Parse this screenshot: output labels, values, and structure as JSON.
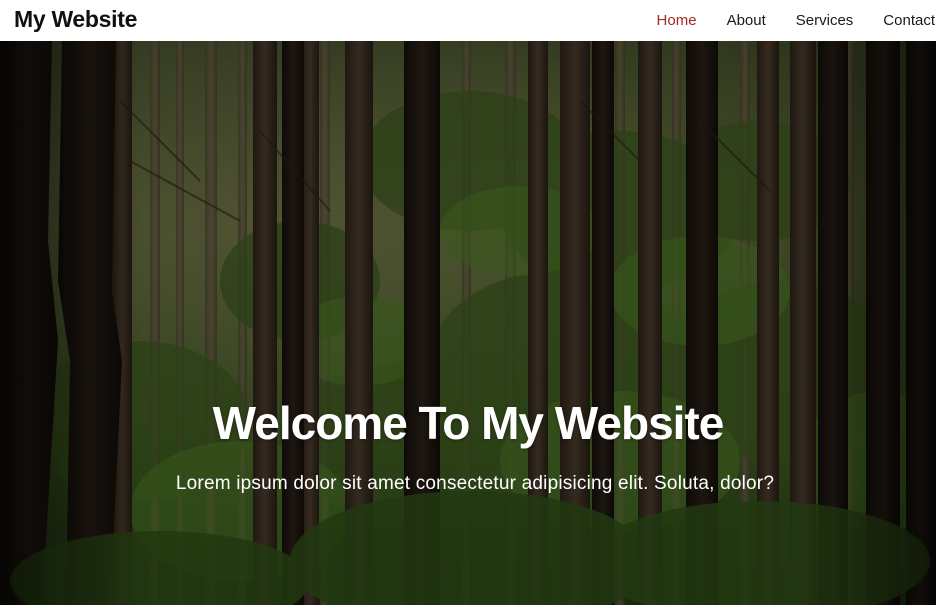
{
  "navbar": {
    "brand": "My Website",
    "links": [
      {
        "label": "Home",
        "active": true
      },
      {
        "label": "About",
        "active": false
      },
      {
        "label": "Services",
        "active": false
      },
      {
        "label": "Contact",
        "active": false
      }
    ],
    "active_color": "#a32a1e",
    "background": "#ffffff"
  },
  "hero": {
    "title": "Welcome To My Website",
    "subtitle": "Lorem ipsum dolor sit amet consectetur adipisicing elit. Soluta, dolor?",
    "background_image": "forest-trees"
  }
}
